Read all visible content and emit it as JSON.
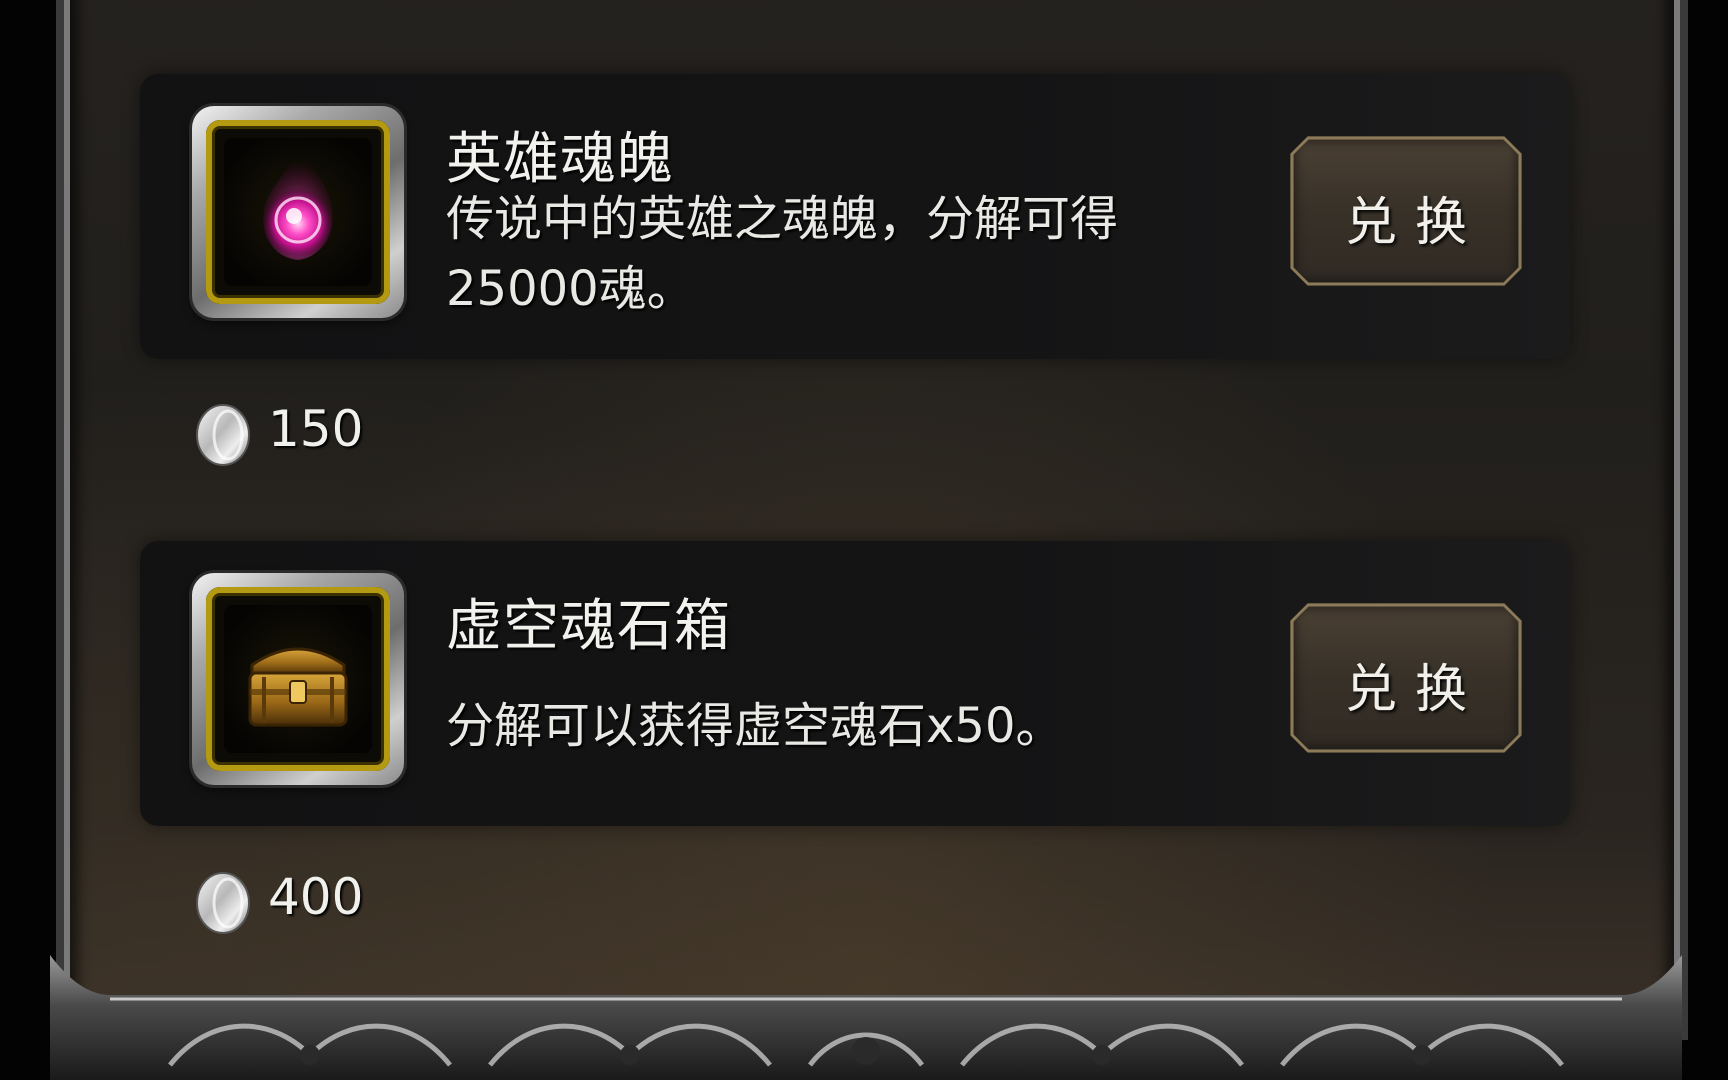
{
  "items": [
    {
      "name": "英雄魂魄",
      "description": "传说中的英雄之魂魄，分解可得25000魂。",
      "button_label": "兑换",
      "price": "150",
      "icon": "pink-soul-orb-icon"
    },
    {
      "name": "虚空魂石箱",
      "description": "分解可以获得虚空魂石x50。",
      "button_label": "兑换",
      "price": "400",
      "icon": "golden-chest-icon"
    }
  ],
  "currency_icon": "silver-coin-icon",
  "colors": {
    "background": "#221f1c",
    "panel": "#131314",
    "icon_border_gold": "#b49a12",
    "text": "#f1f1ee",
    "button": "#3b342b"
  }
}
